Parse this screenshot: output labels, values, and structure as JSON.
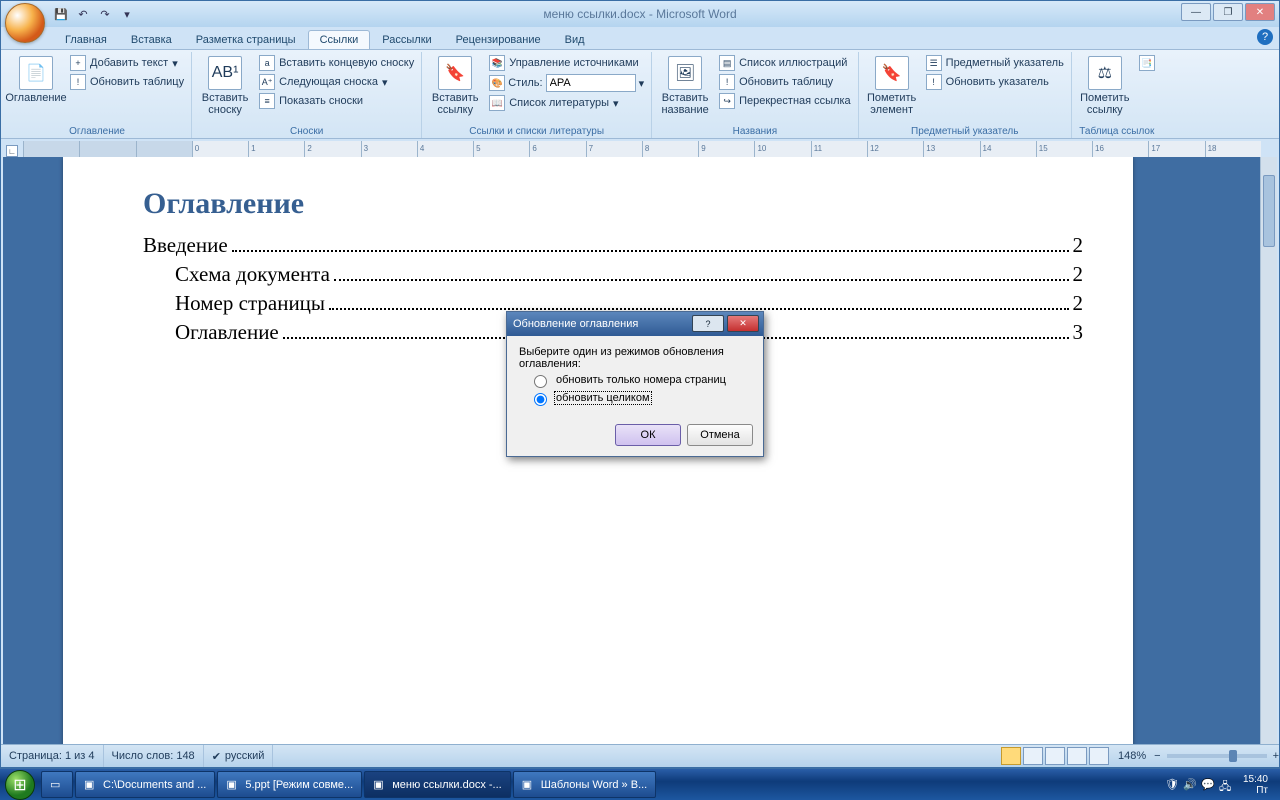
{
  "app": {
    "title": "меню ссылки.docx - Microsoft Word"
  },
  "qat": {
    "save": "💾",
    "undo": "↶",
    "redo": "↷"
  },
  "wincontrols": {
    "min": "—",
    "max": "❐",
    "close": "✕"
  },
  "tabs": [
    "Главная",
    "Вставка",
    "Разметка страницы",
    "Ссылки",
    "Рассылки",
    "Рецензирование",
    "Вид"
  ],
  "active_tab_index": 3,
  "ribbon": {
    "g1": {
      "label": "Оглавление",
      "main": "Оглавление",
      "add_text": "Добавить текст",
      "update": "Обновить таблицу"
    },
    "g2": {
      "label": "Сноски",
      "main": "Вставить сноску",
      "end": "Вставить концевую сноску",
      "next": "Следующая сноска",
      "show": "Показать сноски"
    },
    "g3": {
      "label": "Ссылки и списки литературы",
      "main": "Вставить ссылку",
      "manage": "Управление источниками",
      "style_label": "Стиль:",
      "style_value": "APA",
      "biblio": "Список литературы"
    },
    "g4": {
      "label": "Названия",
      "main": "Вставить название",
      "figs": "Список иллюстраций",
      "update": "Обновить таблицу",
      "xref": "Перекрестная ссылка"
    },
    "g5": {
      "label": "Предметный указатель",
      "main": "Пометить элемент",
      "index": "Предметный указатель",
      "update": "Обновить указатель"
    },
    "g6": {
      "label": "Таблица ссылок",
      "main": "Пометить ссылку"
    }
  },
  "document": {
    "heading": "Оглавление",
    "toc": [
      {
        "text": "Введение",
        "page": "2",
        "indent": false
      },
      {
        "text": "Схема документа",
        "page": "2",
        "indent": true
      },
      {
        "text": "Номер страницы",
        "page": "2",
        "indent": true
      },
      {
        "text": "Оглавление",
        "page": "3",
        "indent": true
      }
    ]
  },
  "dialog": {
    "title": "Обновление оглавления",
    "prompt": "Выберите один из режимов обновления оглавления:",
    "opt1": "обновить только номера страниц",
    "opt2": "обновить целиком",
    "ok": "ОК",
    "cancel": "Отмена",
    "help": "?",
    "close": "✕"
  },
  "status": {
    "page": "Страница: 1 из 4",
    "words": "Число слов: 148",
    "lang": "русский",
    "zoom": "148%"
  },
  "taskbar": {
    "items": [
      {
        "label": "C:\\Documents and ..."
      },
      {
        "label": "5.ppt [Режим совме..."
      },
      {
        "label": "меню ссылки.docx -...",
        "active": true
      },
      {
        "label": "Шаблоны Word » В..."
      }
    ],
    "clock_time": "15:40",
    "clock_day": "Пт"
  }
}
